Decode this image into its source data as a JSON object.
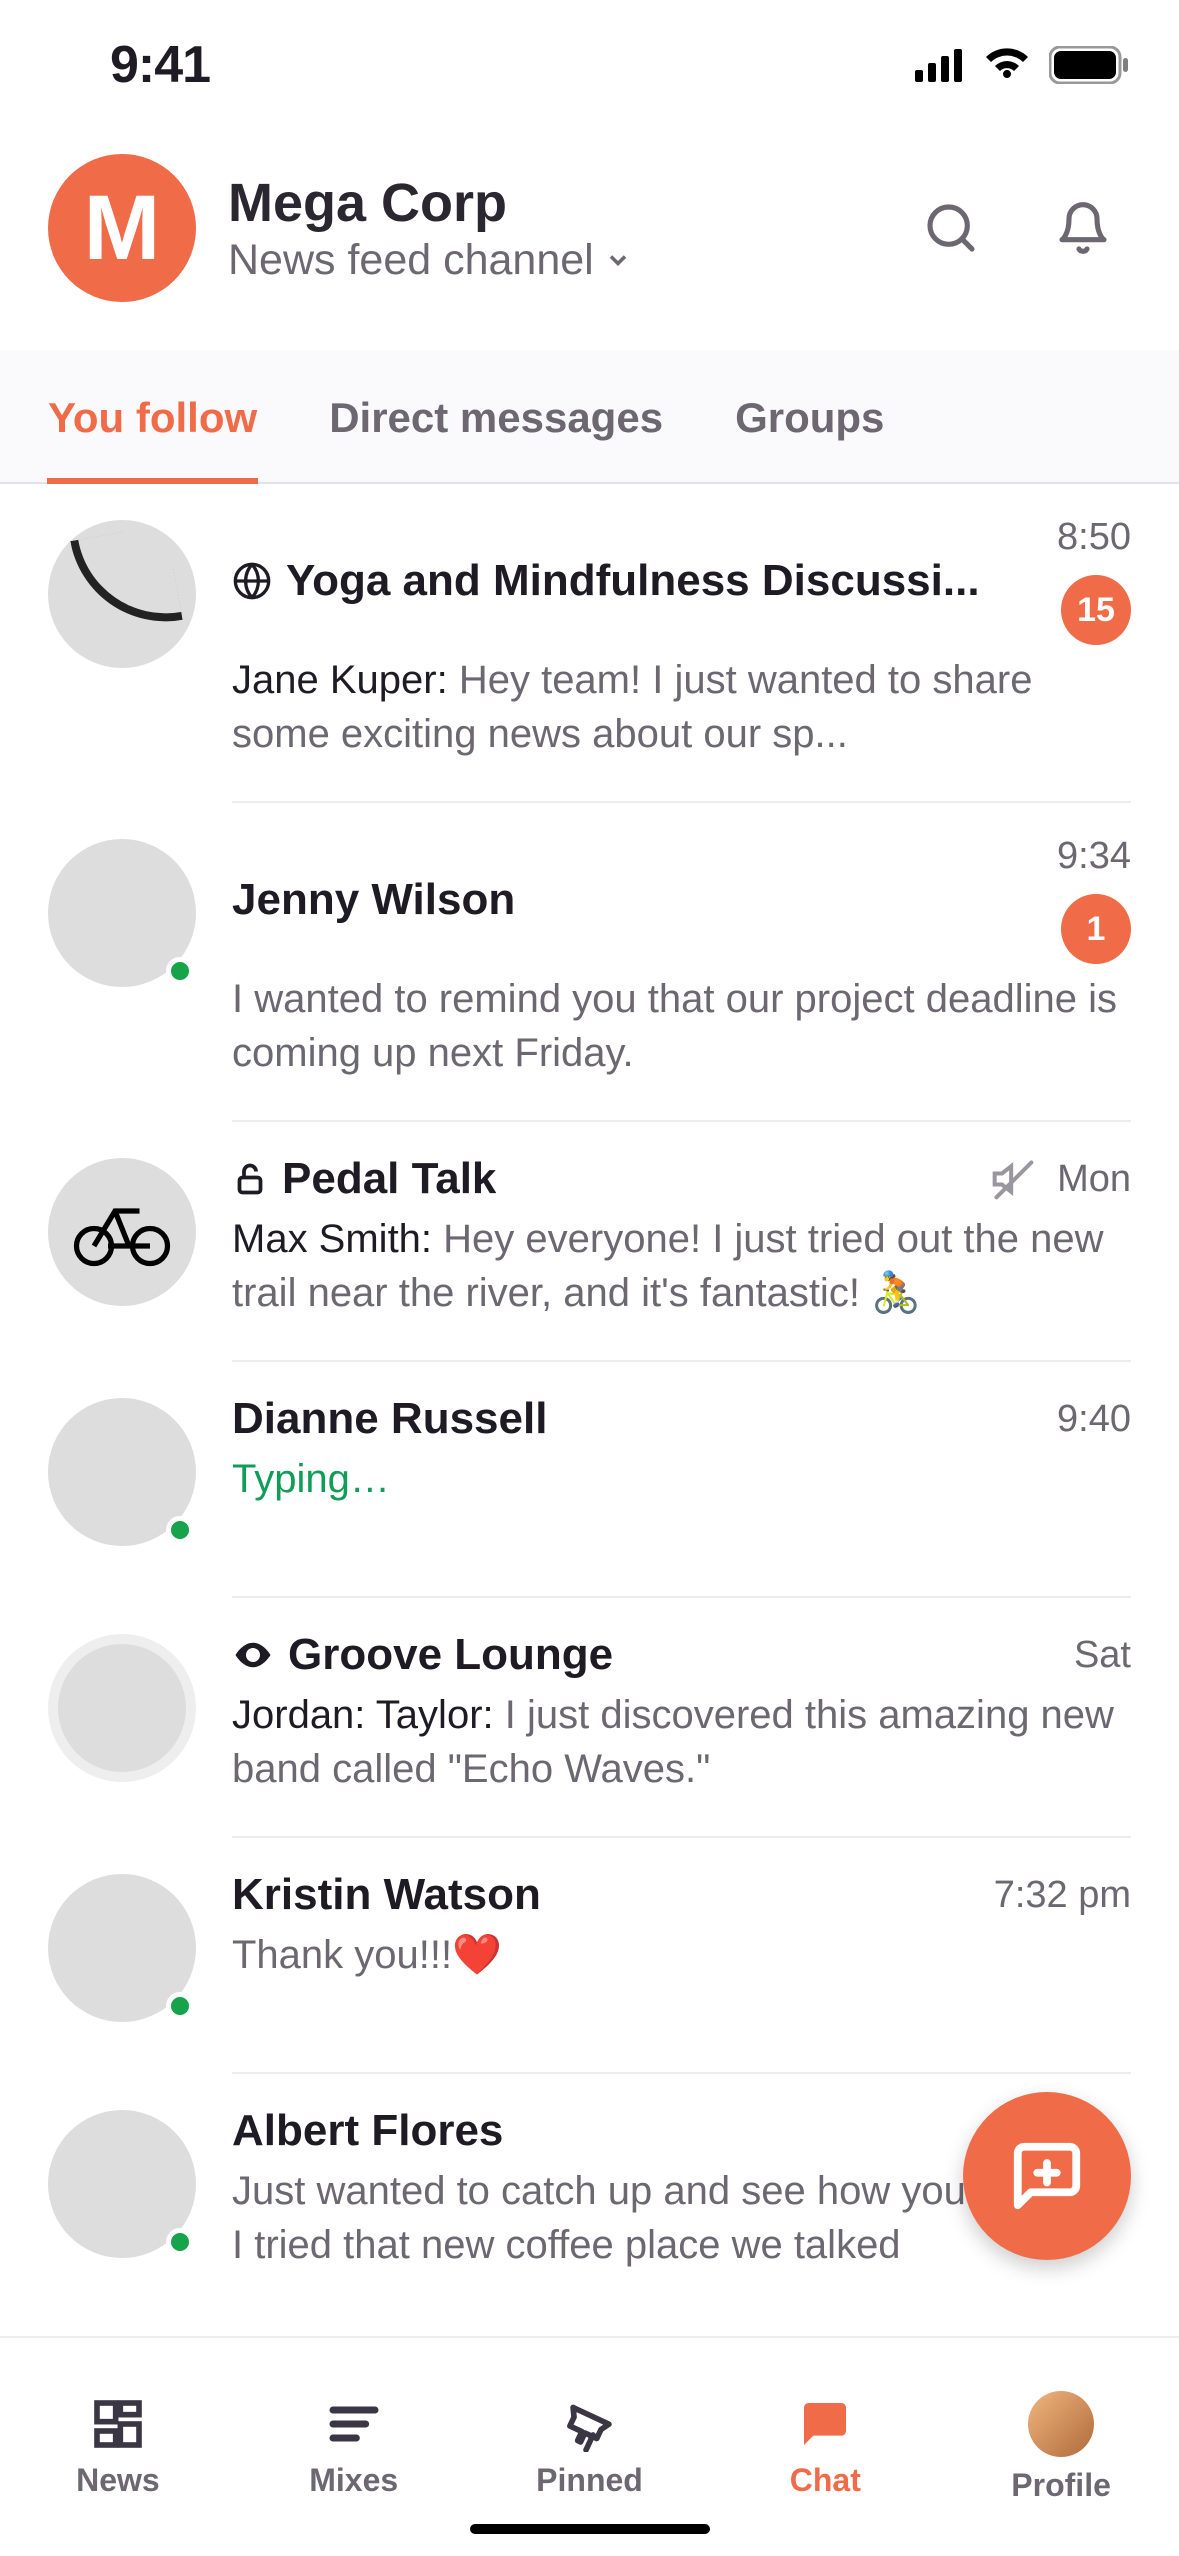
{
  "status": {
    "time": "9:41"
  },
  "header": {
    "workspace_initial": "M",
    "workspace_name": "Mega Corp",
    "subtitle": "News feed channel"
  },
  "tabs": {
    "you_follow": "You follow",
    "direct_messages": "Direct messages",
    "groups": "Groups"
  },
  "conversations": [
    {
      "title": "Yoga and Mindfulness Discussi...",
      "timestamp": "8:50",
      "sender": "Jane Kuper:",
      "preview": "Hey team! I just wanted to share some exciting news about our sp...",
      "badge": "15",
      "title_icon": "globe"
    },
    {
      "title": "Jenny Wilson",
      "timestamp": "9:34",
      "preview": "I wanted to remind you that our project deadline is coming up next Friday.",
      "badge": "1",
      "presence": true
    },
    {
      "title": "Pedal Talk",
      "timestamp": "Mon",
      "sender": "Max Smith:",
      "preview": "Hey everyone! I just tried out the new trail near the river, and it's fantastic! 🚴",
      "title_icon": "lock",
      "muted": true
    },
    {
      "title": "Dianne Russell",
      "timestamp": "9:40",
      "typing": "Typing…",
      "presence": true
    },
    {
      "title": "Groove Lounge",
      "timestamp": "Sat",
      "sender": "Jordan: Taylor:",
      "preview": "I just discovered this amazing new band called \"Echo Waves.\"",
      "title_icon": "eye"
    },
    {
      "title": "Kristin Watson",
      "timestamp": "7:32 pm",
      "preview": "Thank you!!!❤️",
      "presence": true
    },
    {
      "title": "Albert Flores",
      "timestamp": "",
      "preview": "Just wanted to catch up and see how you're doing. I tried that new coffee place we talked",
      "presence": true
    }
  ],
  "nav": {
    "news": "News",
    "mixes": "Mixes",
    "pinned": "Pinned",
    "chat": "Chat",
    "profile": "Profile"
  }
}
